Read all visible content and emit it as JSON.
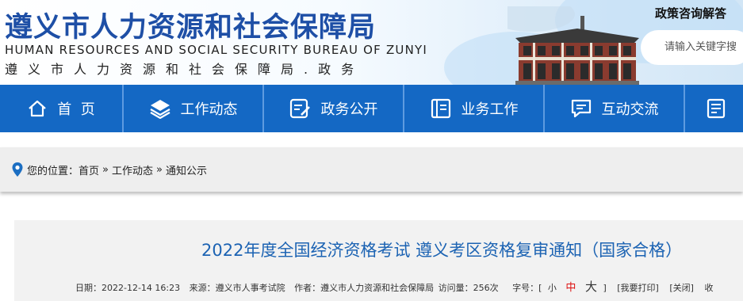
{
  "header": {
    "title": "遵义市人力资源和社会保障局",
    "subtitle_en": "HUMAN RESOURCES AND SOCIAL SECURITY BUREAU OF ZUNYI",
    "subtitle_cn": "遵义市人力资源和社会保障局.政务",
    "policy_title": "政策咨询解答",
    "search_placeholder": "请输入关键字搜"
  },
  "nav": {
    "items": [
      {
        "label": "首  页",
        "icon": "home-icon"
      },
      {
        "label": "工作动态",
        "icon": "layers-icon"
      },
      {
        "label": "政务公开",
        "icon": "edit-document-icon"
      },
      {
        "label": "业务工作",
        "icon": "book-icon"
      },
      {
        "label": "互动交流",
        "icon": "chat-icon"
      },
      {
        "label": "",
        "icon": "list-document-icon"
      }
    ],
    "colors": {
      "bar": "#1468c4",
      "divider": "#5e9be0"
    }
  },
  "breadcrumb": {
    "prefix": "您的位置：",
    "items": [
      "首页",
      "工作动态",
      "通知公示"
    ],
    "separator": "»"
  },
  "article": {
    "title": "2022年度全国经济资格考试 遵义考区资格复审通知（国家合格）",
    "date": "日期：2022-12-14 16:23",
    "source": "来源：遵义市人事考试院",
    "author": "作者：遵义市人力资源和社会保障局",
    "views": "访问量：256次",
    "font_size_label": "字号：[",
    "font_small": "小",
    "font_medium": "中",
    "font_large": "大",
    "font_close": "]",
    "print": "[我要打印]",
    "close": "[关闭]",
    "trailing": "收"
  },
  "colors": {
    "title_blue": "#1e4fa6",
    "article_title": "#1c63b3",
    "accent_red": "#dd1111"
  }
}
